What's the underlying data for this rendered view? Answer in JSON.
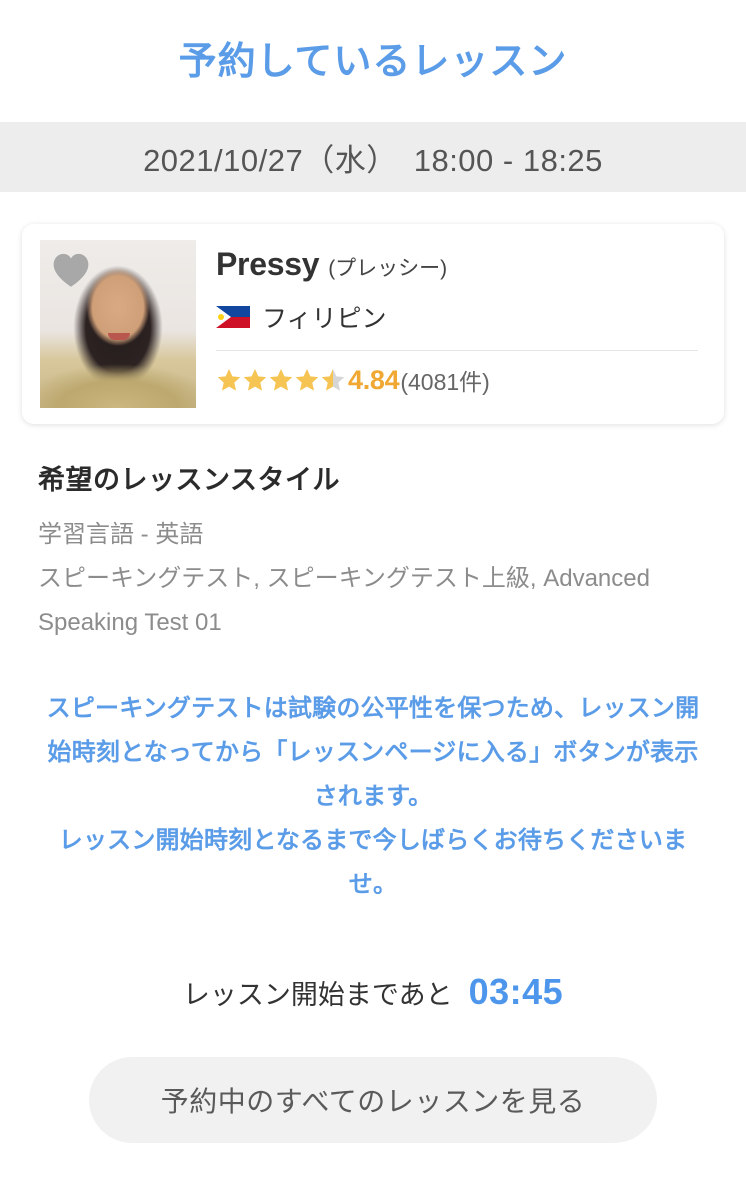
{
  "header": {
    "title": "予約しているレッスン",
    "title_color": "#5b9ce8"
  },
  "date_bar": {
    "text": "2021/10/27（水）　18:00 - 18:25",
    "background_color": "#ededed"
  },
  "teacher_card": {
    "favorite_icon": "heart-icon",
    "favorite_color": "#a8a8a8",
    "name": "Pressy",
    "name_kana": "(プレッシー)",
    "country_flag_icon": "philippines-flag-icon",
    "country": "フィリピン",
    "rating": {
      "stars_filled": 4.5,
      "value": "4.84",
      "count": "(4081件)",
      "star_color": "#f5c453",
      "star_empty_color": "#d6d6d6",
      "value_color": "#f0a832"
    }
  },
  "lesson_style": {
    "heading": "希望のレッスンスタイル",
    "language_line": "学習言語 - 英語",
    "materials_line": "スピーキングテスト, スピーキングテスト上級, Advanced Speaking Test 01"
  },
  "notice": {
    "paragraph1": "スピーキングテストは試験の公平性を保つため、レッスン開始時刻となってから「レッスンページに入る」ボタンが表示されます。",
    "paragraph2": "レッスン開始時刻となるまで今しばらくお待ちくださいませ。",
    "color": "#5b9ce8"
  },
  "countdown": {
    "label": "レッスン開始まであと",
    "value": "03:45",
    "value_color": "#4d96ec"
  },
  "footer": {
    "all_lessons_button_label": "予約中のすべてのレッスンを見る"
  }
}
